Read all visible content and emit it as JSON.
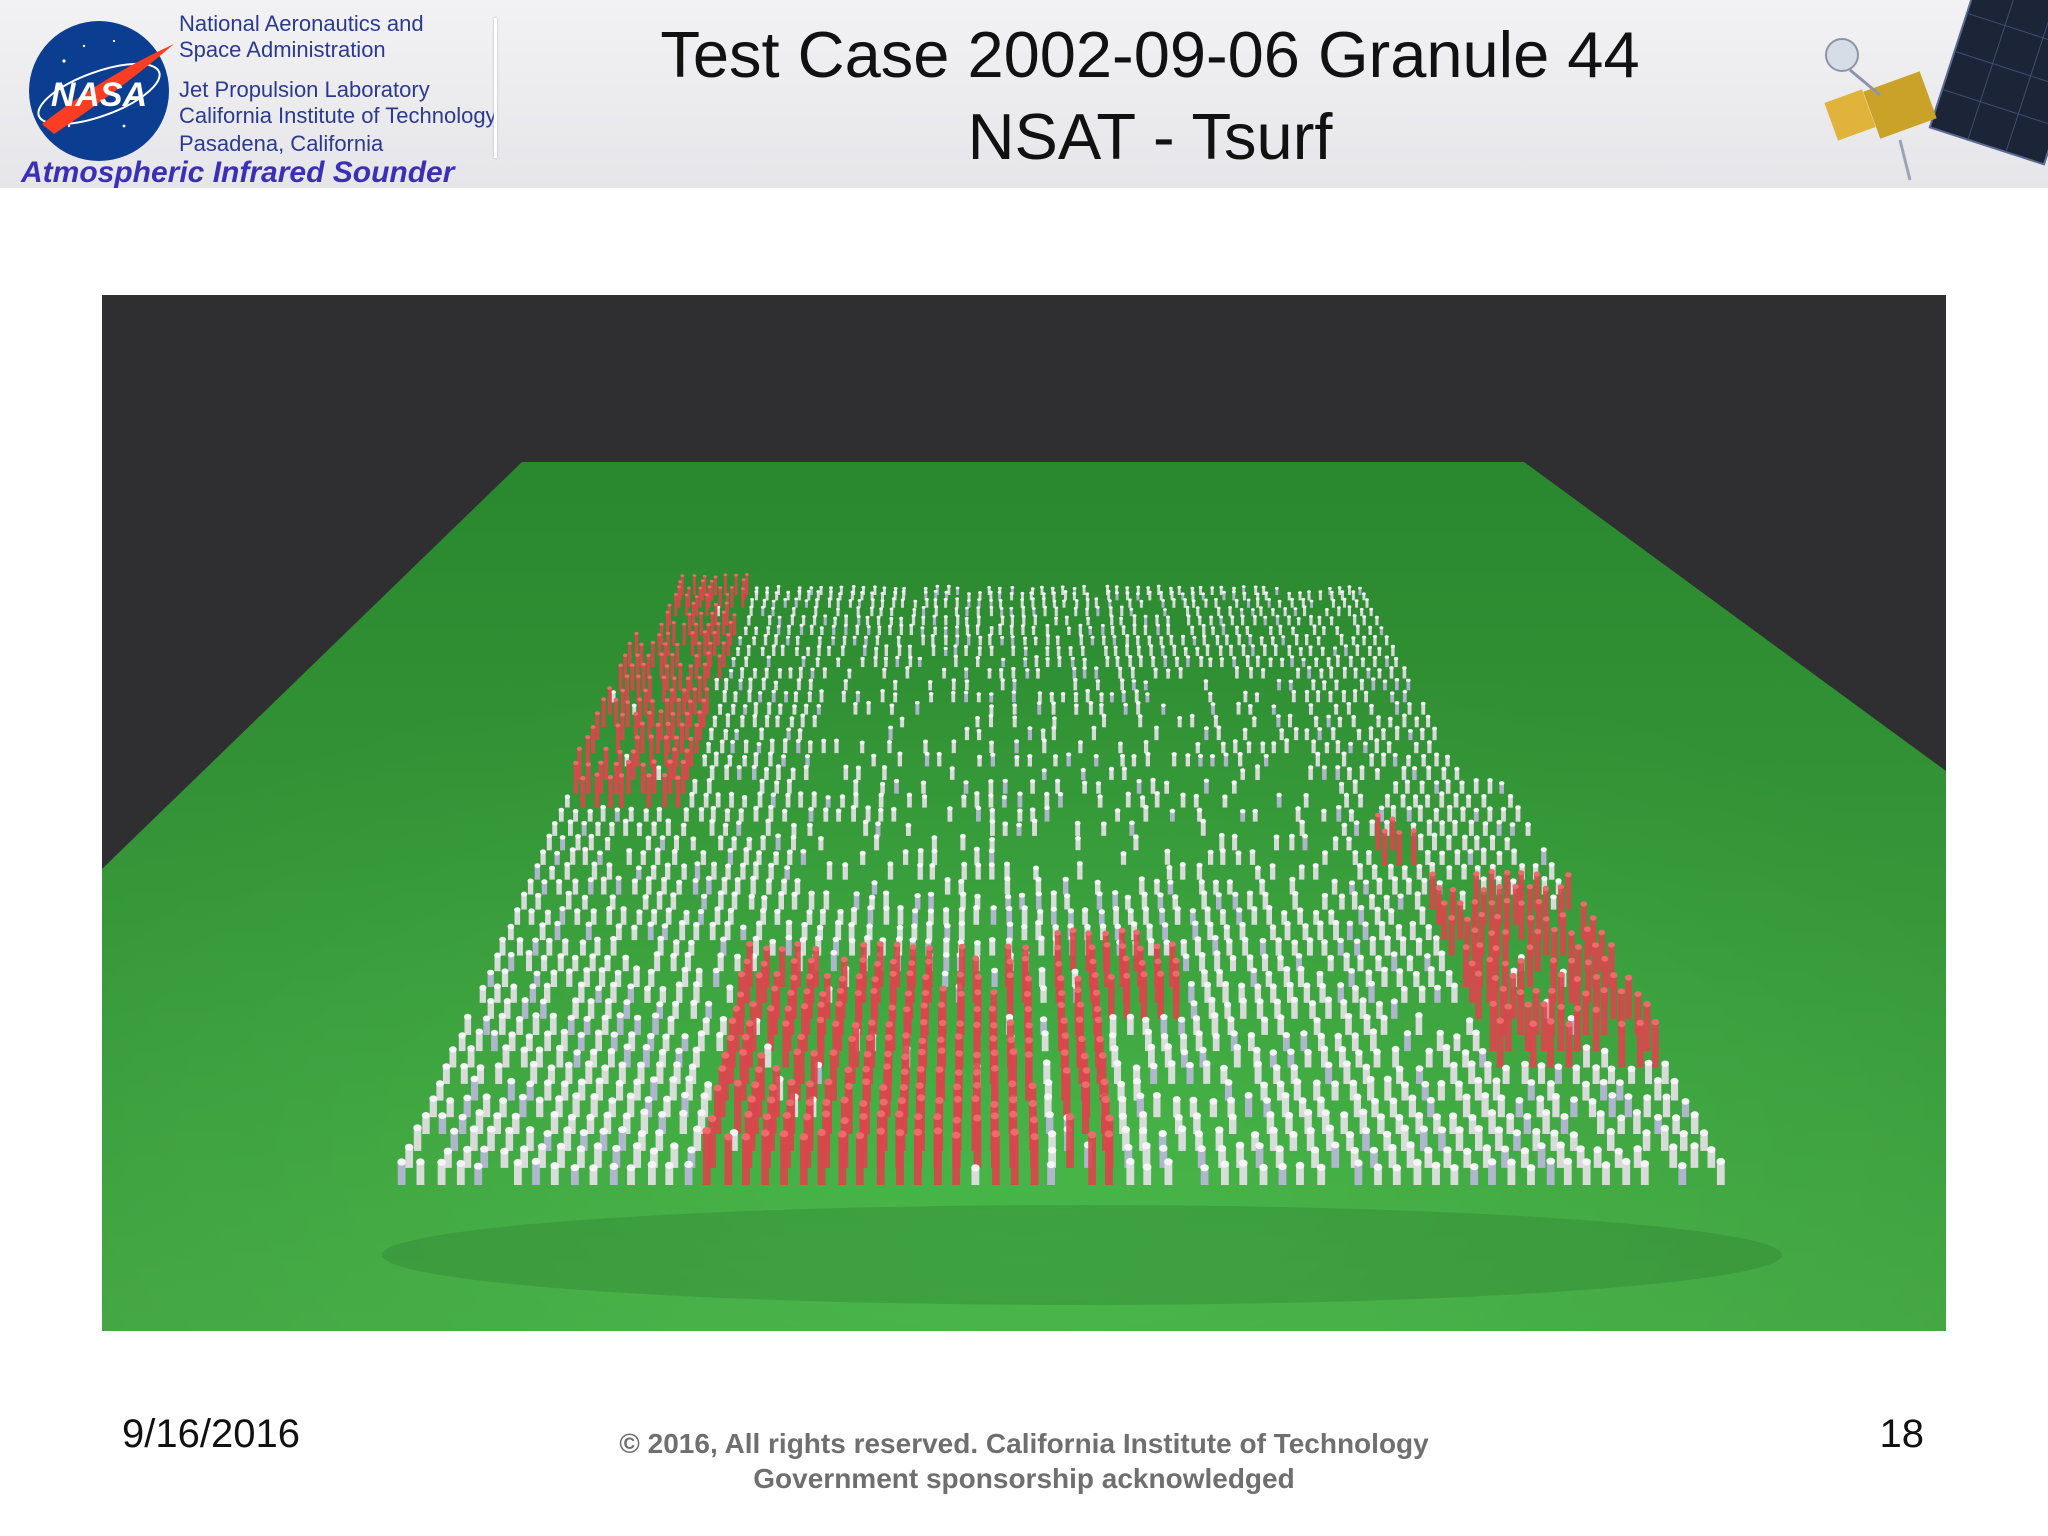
{
  "header": {
    "org_lines": [
      "National Aeronautics and",
      "Space Administration",
      "Jet Propulsion Laboratory",
      "California Institute of Technology",
      "Pasadena, California"
    ],
    "program_name": "Atmospheric Infrared Sounder",
    "logo_text": "NASA",
    "logo_icon": "nasa-meatball-logo",
    "satellite_icon": "satellite-illustration"
  },
  "slide": {
    "title_line1": "Test Case 2002-09-06 Granule 44",
    "title_line2": "NSAT - Tsurf"
  },
  "visualization": {
    "description_icon": "3d-bar-surface-rendering",
    "colors": {
      "background": "#2f2f31",
      "ground": "#46b94a",
      "warm": "#d9474b",
      "neutral": "#e4e1e6",
      "cool": "#b7b7d8"
    }
  },
  "footer": {
    "date": "9/16/2016",
    "copyright_line1": "© 2016, All rights reserved. California Institute of Technology",
    "copyright_line2": "Government sponsorship acknowledged",
    "page_number": "18"
  }
}
